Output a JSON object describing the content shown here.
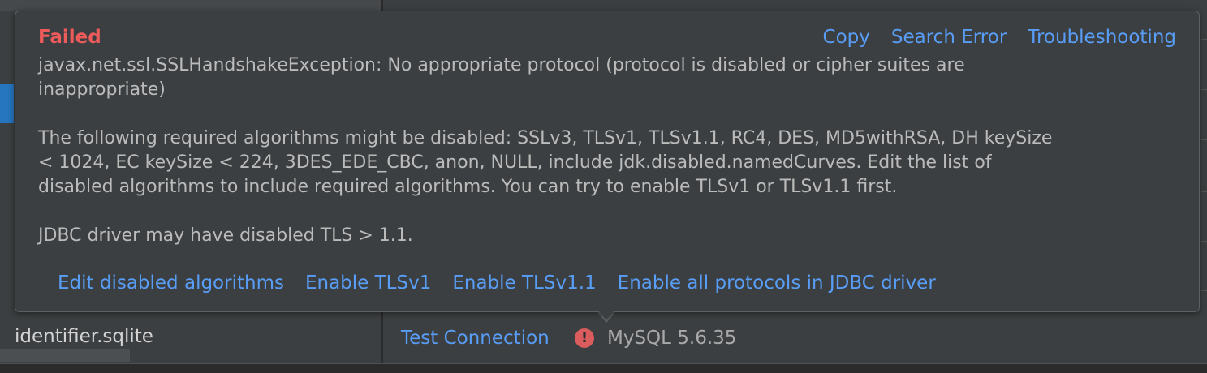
{
  "popup": {
    "status": "Failed",
    "actions": {
      "copy": "Copy",
      "search_error": "Search Error",
      "troubleshooting": "Troubleshooting"
    },
    "exception": [
      "javax.net.ssl.SSLHandshakeException: No appropriate protocol (protocol is disabled or cipher suites are",
      "inappropriate)"
    ],
    "algorithms_note": [
      "The following required algorithms might be disabled: SSLv3, TLSv1, TLSv1.1, RC4, DES, MD5withRSA, DH keySize",
      "< 1024, EC keySize < 224, 3DES_EDE_CBC, anon, NULL, include jdk.disabled.namedCurves. Edit the list of",
      "disabled algorithms to include required algorithms. You can try to enable TLSv1 or TLSv1.1 first."
    ],
    "driver_note": "JDBC driver may have disabled TLS > 1.1.",
    "fixes": {
      "edit_algorithms": "Edit disabled algorithms",
      "enable_tlsv1": "Enable TLSv1",
      "enable_tlsv11": "Enable TLSv1.1",
      "enable_all": "Enable all protocols in JDBC driver"
    }
  },
  "left_panel": {
    "file": "identifier.sqlite"
  },
  "footer": {
    "test_connection": "Test Connection",
    "error_icon": "!",
    "version": "MySQL 5.6.35"
  },
  "colors": {
    "error": "#ee5b5b",
    "link": "#589df6",
    "background": "#3c3f41",
    "text": "#bbbbbb"
  }
}
